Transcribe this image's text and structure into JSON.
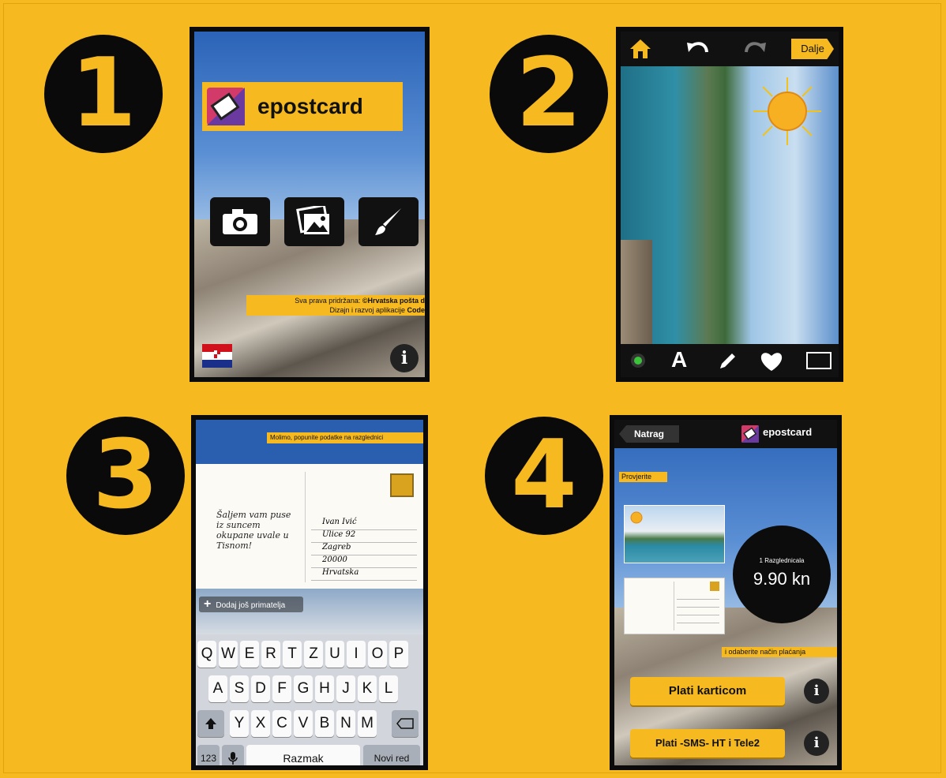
{
  "steps": [
    "1",
    "2",
    "3",
    "4"
  ],
  "screen1": {
    "brand": "epostcard",
    "copyright_line1_prefix": "Sva prava pridržana: ",
    "copyright_line1_strong": "©Hrvatska pošta d.d",
    "copyright_line2_prefix": "Dizajn i razvoj aplikacije ",
    "copyright_line2_strong": "CodeIT",
    "info": "i",
    "icons": [
      "camera-icon",
      "gallery-icon",
      "brush-icon",
      "croatia-flag-icon"
    ]
  },
  "screen2": {
    "next_button": "Dalje",
    "text_tool": "A",
    "icons": [
      "home-icon",
      "undo-icon",
      "redo-icon",
      "sun-sticker-icon",
      "color-dot-icon",
      "pencil-icon",
      "heart-icon",
      "frame-icon"
    ]
  },
  "screen3": {
    "hint": "Molimo, popunite podatke na razglednici",
    "message": "Šaljem vam puse iz suncem okupane uvale u Tisnom!",
    "address": [
      "Ivan Ivić",
      "Ulice 92",
      "Zagreb",
      "20000",
      "Hrvatska"
    ],
    "add_recipient": "Dodaj još primatelja",
    "keyboard": {
      "row1": [
        "Q",
        "W",
        "E",
        "R",
        "T",
        "Z",
        "U",
        "I",
        "O",
        "P"
      ],
      "row2": [
        "A",
        "S",
        "D",
        "F",
        "G",
        "H",
        "J",
        "K",
        "L"
      ],
      "row3": [
        "Y",
        "X",
        "C",
        "V",
        "B",
        "N",
        "M"
      ],
      "numbers_key": "123",
      "space_key": "Razmak",
      "return_key": "Novi red"
    }
  },
  "screen4": {
    "back_button": "Natrag",
    "brand": "epostcard",
    "check_label": "Provjerite",
    "price_caption": "1 Razglednicala",
    "price": "9.90 kn",
    "payment_label": "i odaberite način plaćanja",
    "pay_card": "Plati karticom",
    "pay_sms": "Plati -SMS- HT i Tele2",
    "info": "i"
  },
  "colors": {
    "background": "#f6b91f",
    "accent": "#f6b91f",
    "black": "#0b0b0b"
  }
}
